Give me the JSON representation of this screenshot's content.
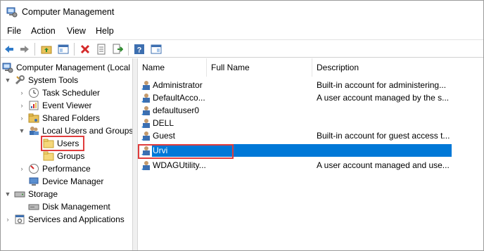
{
  "window": {
    "title": "Computer Management"
  },
  "menu": [
    "File",
    "Action",
    "View",
    "Help"
  ],
  "toolbar": {
    "buttons": [
      "back-arrow-icon",
      "forward-arrow-icon",
      "up-folder-icon",
      "show-hide-tree-icon",
      "delete-icon",
      "properties-icon",
      "export-list-icon",
      "help-icon",
      "show-hide-action-pane-icon"
    ]
  },
  "tree": {
    "root": "Computer Management (Local",
    "system_tools": "System Tools",
    "task_scheduler": "Task Scheduler",
    "event_viewer": "Event Viewer",
    "shared_folders": "Shared Folders",
    "local_users_groups": "Local Users and Groups",
    "users": "Users",
    "groups": "Groups",
    "performance": "Performance",
    "device_manager": "Device Manager",
    "storage": "Storage",
    "disk_management": "Disk Management",
    "services_apps": "Services and Applications"
  },
  "list": {
    "columns": [
      "Name",
      "Full Name",
      "Description"
    ],
    "rows": [
      {
        "name": "Administrator",
        "full_name": "",
        "description": "Built-in account for administering..."
      },
      {
        "name": "DefaultAcco...",
        "full_name": "",
        "description": "A user account managed by the s..."
      },
      {
        "name": "defaultuser0",
        "full_name": "",
        "description": ""
      },
      {
        "name": "DELL",
        "full_name": "",
        "description": ""
      },
      {
        "name": "Guest",
        "full_name": "",
        "description": "Built-in account for guest access t..."
      },
      {
        "name": "Urvi",
        "full_name": "",
        "description": ""
      },
      {
        "name": "WDAGUtility...",
        "full_name": "",
        "description": "A user account managed and use..."
      }
    ]
  },
  "colors": {
    "selection": "#0078d7",
    "highlight": "#e03c3c"
  }
}
